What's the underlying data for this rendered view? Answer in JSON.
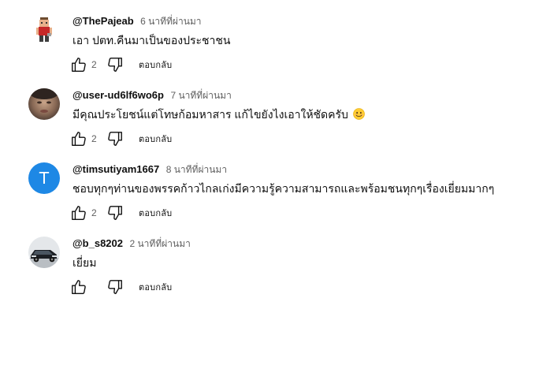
{
  "comments": [
    {
      "author": "@ThePajeab",
      "time": "6 นาทีที่ผ่านมา",
      "text": "เอา ปตท.คืนมาเป็นของประชาชน",
      "likes": "2",
      "reply_label": "ตอบกลับ",
      "avatar": "pixel-figure-avatar"
    },
    {
      "author": "@user-ud6lf6wo6p",
      "time": "7 นาทีที่ผ่านมา",
      "text": "มีคุณประโยชน์แต่โทษก้อมหาสาร แก้ไขยังไงเอาให้ชัดครับ",
      "emoji": "smiling-face-emoji",
      "likes": "2",
      "reply_label": "ตอบกลับ",
      "avatar": "photo-avatar"
    },
    {
      "author": "@timsutiyam1667",
      "time": "8 นาทีที่ผ่านมา",
      "text": "ชอบทุกๆท่านของพรรคก้าวไกลเก่งมีความรู้ความสามารถและพร้อมชนทุกๆเรื่องเยี่ยมมากๆ",
      "likes": "2",
      "reply_label": "ตอบกลับ",
      "avatar_letter": "T",
      "avatar_color": "#1e88e5"
    },
    {
      "author": "@b_s8202",
      "time": "2 นาทีที่ผ่านมา",
      "text": "เยี่ยม",
      "likes": "",
      "reply_label": "ตอบกลับ",
      "avatar": "car-photo-avatar"
    }
  ],
  "icons": {
    "like": "thumb-up-icon",
    "dislike": "thumb-down-icon"
  },
  "colors": {
    "text": "#0f0f0f",
    "secondary": "#606060"
  }
}
